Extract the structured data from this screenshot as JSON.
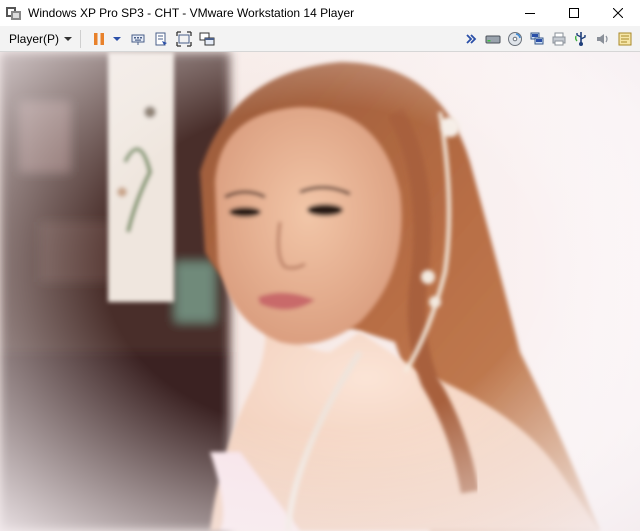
{
  "window": {
    "title": "Windows XP Pro SP3 - CHT - VMware Workstation 14 Player"
  },
  "toolbar": {
    "player_menu_label": "Player(P)"
  },
  "icons": {
    "app": "vmware-app-icon",
    "minimize": "minimize-icon",
    "maximize": "maximize-icon",
    "close": "close-icon",
    "pause": "pause-icon",
    "send_ctrl_alt_del": "ctrl-alt-del-icon",
    "removable_devices": "removable-devices-icon",
    "fullscreen": "fullscreen-icon",
    "unity": "unity-icon",
    "more_devices": "double-chevron-icon",
    "hard_disk": "hard-disk-icon",
    "cd_dvd": "cd-dvd-icon",
    "network": "network-adapter-icon",
    "printer": "printer-icon",
    "usb": "usb-icon",
    "sound": "sound-icon",
    "message_log": "message-log-icon"
  },
  "colors": {
    "toolbar_bg": "#f3f3f3",
    "pause_orange": "#e8812b",
    "accent_blue": "#2a4fa8"
  }
}
